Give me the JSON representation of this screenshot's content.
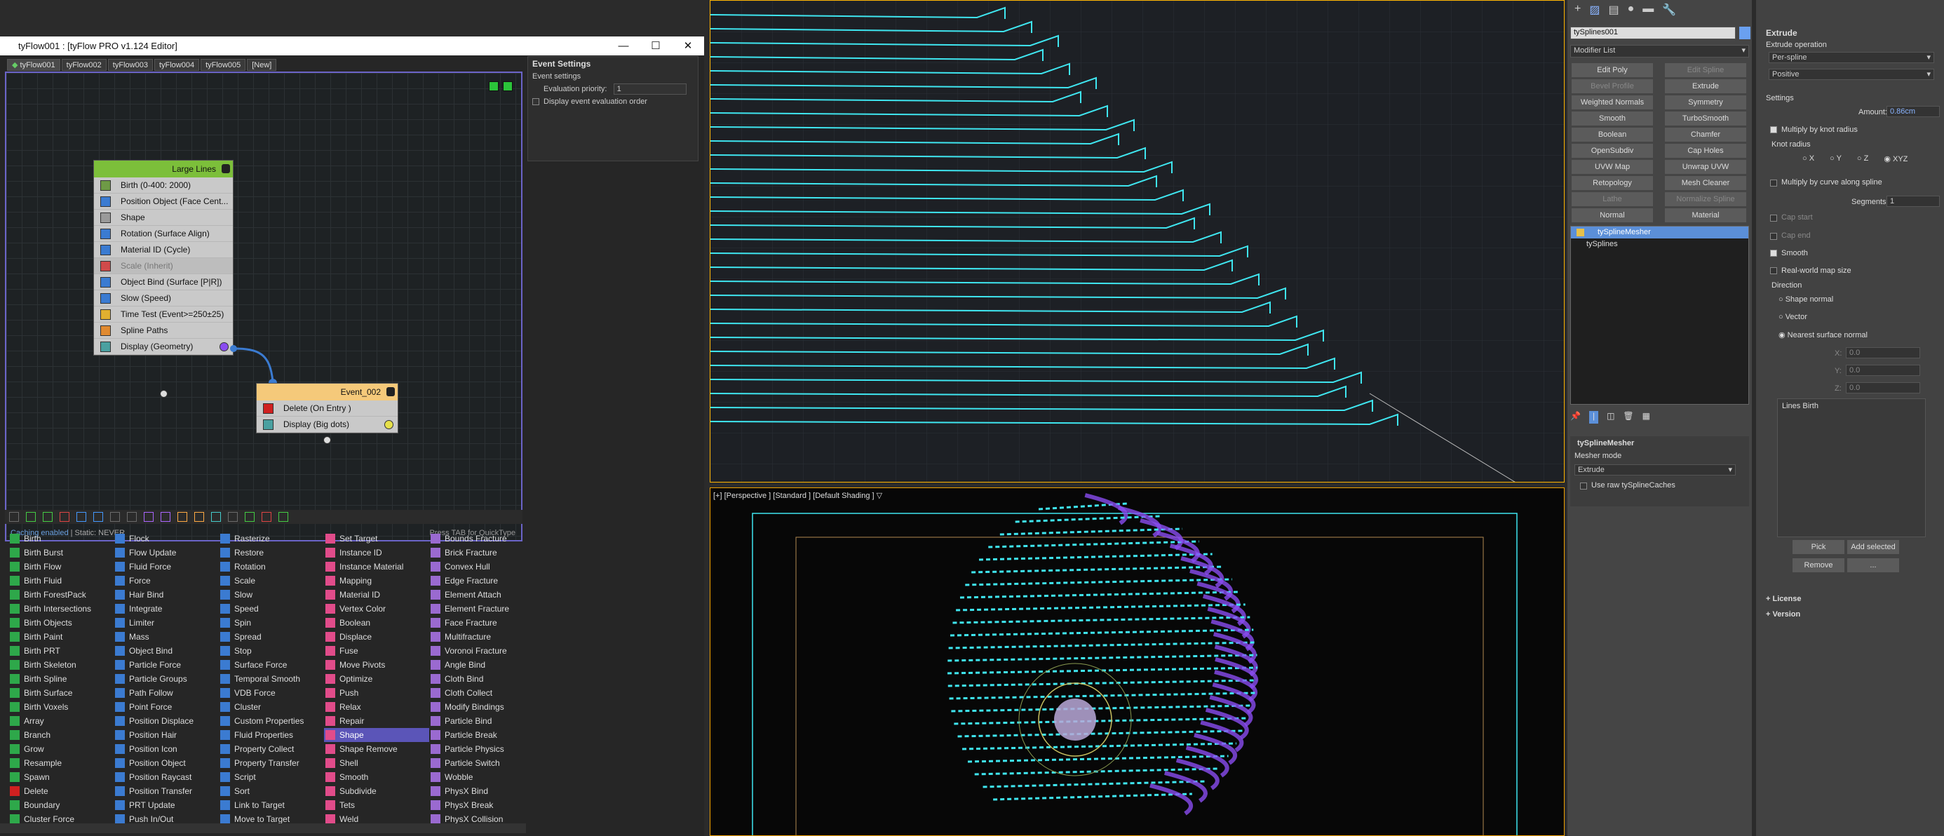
{
  "window": {
    "title": "tyFlow001 : [tyFlow PRO v1.124 Editor]"
  },
  "tabs": [
    "tyFlow001",
    "tyFlow002",
    "tyFlow003",
    "tyFlow004",
    "tyFlow005",
    "[New]"
  ],
  "node1": {
    "title": "Large Lines",
    "ops": [
      "Birth (0-400: 2000)",
      "Position Object (Face Cent...",
      "Shape",
      "Rotation (Surface Align)",
      "Material ID (Cycle)",
      "Scale (Inherit)",
      "Object Bind (Surface [P|R])",
      "Slow (Speed)",
      "Time Test (Event>=250±25)",
      "Spline Paths",
      "Display (Geometry)"
    ]
  },
  "node2": {
    "title": "Event_002",
    "ops": [
      "Delete (On Entry )",
      "Display (Big dots)"
    ]
  },
  "graph_status": {
    "caching": "Caching enabled",
    "static": " | Static: NEVER",
    "hint": "Press TAB for QuickType"
  },
  "event_settings": {
    "header": "Event Settings",
    "sub": "Event settings",
    "priority_label": "Evaluation priority:",
    "priority_value": "1",
    "display_order": "Display event evaluation order"
  },
  "operators": [
    [
      "Birth",
      "Birth Burst",
      "Birth Flow",
      "Birth Fluid",
      "Birth ForestPack",
      "Birth Intersections",
      "Birth Objects",
      "Birth Paint",
      "Birth PRT",
      "Birth Skeleton",
      "Birth Spline",
      "Birth Surface",
      "Birth Voxels",
      "Array",
      "Branch",
      "Grow",
      "Resample",
      "Spawn",
      "Delete",
      "Boundary",
      "Cluster Force"
    ],
    [
      "Flock",
      "Flow Update",
      "Fluid Force",
      "Force",
      "Hair Bind",
      "Integrate",
      "Limiter",
      "Mass",
      "Object Bind",
      "Particle Force",
      "Particle Groups",
      "Path Follow",
      "Point Force",
      "Position Displace",
      "Position Hair",
      "Position Icon",
      "Position Object",
      "Position Raycast",
      "Position Transfer",
      "PRT Update",
      "Push In/Out"
    ],
    [
      "Rasterize",
      "Restore",
      "Rotation",
      "Scale",
      "Slow",
      "Speed",
      "Spin",
      "Spread",
      "Stop",
      "Surface Force",
      "Temporal Smooth",
      "VDB Force",
      "Cluster",
      "Custom Properties",
      "Fluid Properties",
      "Property Collect",
      "Property Transfer",
      "Script",
      "Sort",
      "Link to Target",
      "Move to Target"
    ],
    [
      "Set Target",
      "Instance ID",
      "Instance Material",
      "Mapping",
      "Material ID",
      "Vertex Color",
      "Boolean",
      "Displace",
      "Fuse",
      "Move Pivots",
      "Optimize",
      "Push",
      "Relax",
      "Repair",
      "Shape",
      "Shape Remove",
      "Shell",
      "Smooth",
      "Subdivide",
      "Tets",
      "Weld"
    ],
    [
      "Bounds Fracture",
      "Brick Fracture",
      "Convex Hull",
      "Edge Fracture",
      "Element Attach",
      "Element Fracture",
      "Face Fracture",
      "Multifracture",
      "Voronoi Fracture",
      "Angle Bind",
      "Cloth Bind",
      "Cloth Collect",
      "Modify Bindings",
      "Particle Bind",
      "Particle Break",
      "Particle Physics",
      "Particle Switch",
      "Wobble",
      "PhysX Bind",
      "PhysX Break",
      "PhysX Collision"
    ]
  ],
  "viewport_bottom_label": "[+] [Perspective ] [Standard ] [Default Shading ]",
  "modifier": {
    "object_name": "tySplines001",
    "list_label": "Modifier List",
    "buttons": [
      "Edit Poly",
      "Edit Spline",
      "Bevel Profile",
      "Extrude",
      "Weighted Normals",
      "Symmetry",
      "Smooth",
      "TurboSmooth",
      "Boolean",
      "Chamfer",
      "OpenSubdiv",
      "Cap Holes",
      "UVW Map",
      "Unwrap UVW",
      "Retopology",
      "Mesh Cleaner",
      "Lathe",
      "Normalize Spline",
      "Normal",
      "Material"
    ],
    "stack": [
      "tySplineMesher",
      "tySplines"
    ],
    "rollout_title": "tySplineMesher",
    "mesher_mode_label": "Mesher mode",
    "mesher_mode_value": "Extrude",
    "use_raw": "Use raw tySplineCaches"
  },
  "extrude": {
    "title": "Extrude",
    "op_label": "Extrude operation",
    "op_value": "Per-spline",
    "dir_value": "Positive",
    "settings": "Settings",
    "amount_label": "Amount:",
    "amount_value": "0.86cm",
    "mult_knot": "Multiply by knot radius",
    "knot_radius": "Knot radius",
    "axes": [
      "X",
      "Y",
      "Z",
      "XYZ"
    ],
    "mult_curve": "Multiply by curve along spline",
    "segments_label": "Segments:",
    "segments_value": "1",
    "cap_start": "Cap start",
    "cap_end": "Cap end",
    "smooth": "Smooth",
    "realworld": "Real-world map size",
    "direction": "Direction",
    "dirs": [
      "Shape normal",
      "Vector",
      "Nearest surface normal"
    ],
    "xyz_labels": [
      "X:",
      "Y:",
      "Z:"
    ],
    "xyz_values": [
      "0.0",
      "0.0",
      "0.0"
    ],
    "list_item": "Lines Birth",
    "pick": "Pick",
    "add_selected": "Add selected",
    "remove": "Remove",
    "dots": "...",
    "license": "License",
    "version": "Version"
  },
  "colors": {
    "accent": "#5b55b8",
    "cyan": "#3fe6f0",
    "violet": "#8a4cf0",
    "nodeGreen": "#7cbf3a",
    "nodeOrange": "#f5c97a"
  }
}
